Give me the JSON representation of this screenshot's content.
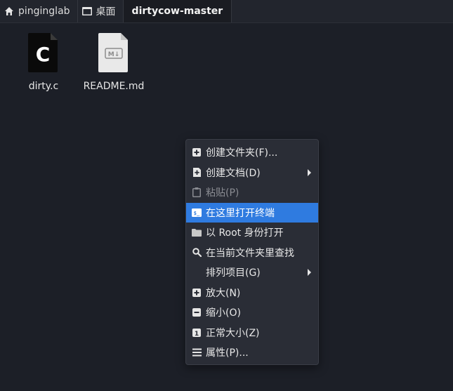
{
  "breadcrumbs": [
    {
      "label": "pinginglab",
      "icon": "home-icon"
    },
    {
      "label": "桌面",
      "icon": "desktop-icon"
    },
    {
      "label": "dirtycow-master",
      "icon": ""
    }
  ],
  "files": [
    {
      "name": "dirty.c",
      "icon": "c-source-file-icon",
      "icon_letter": "C"
    },
    {
      "name": "README.md",
      "icon": "markdown-file-icon",
      "icon_text": "M↓"
    }
  ],
  "context_menu": {
    "items": [
      {
        "label": "创建文件夹(F)...",
        "icon": "add-folder-icon"
      },
      {
        "label": "创建文档(D)",
        "icon": "add-document-icon",
        "submenu": true
      },
      {
        "label": "粘贴(P)",
        "icon": "clipboard-icon",
        "disabled": true
      },
      {
        "label": "在这里打开终端",
        "icon": "terminal-icon",
        "highlighted": true,
        "icon_text": "$_"
      },
      {
        "label": "以 Root 身份打开",
        "icon": "folder-icon"
      },
      {
        "label": "在当前文件夹里查找",
        "icon": "search-icon"
      },
      {
        "label": "排列项目(G)",
        "icon": "",
        "submenu": true
      },
      {
        "label": "放大(N)",
        "icon": "zoom-in-icon"
      },
      {
        "label": "缩小(O)",
        "icon": "zoom-out-icon"
      },
      {
        "label": "正常大小(Z)",
        "icon": "zoom-normal-icon",
        "icon_text": "1"
      },
      {
        "label": "属性(P)...",
        "icon": "properties-icon"
      }
    ]
  },
  "colors": {
    "highlight": "#2f7be0",
    "background": "#1c1f27",
    "menu_bg": "#2a2d36"
  }
}
